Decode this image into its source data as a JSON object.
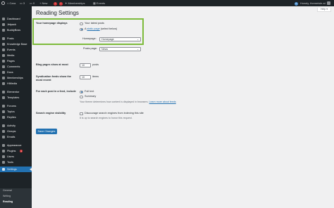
{
  "admin_bar": {
    "site_name": "Cara",
    "comments_count": "3",
    "updates_count": "0",
    "new_label": "+ New",
    "items": [
      "Memberships",
      "Events"
    ],
    "greeting": "Howdy, themeisle-st"
  },
  "sidebar": {
    "items": [
      {
        "label": "Dashboard"
      },
      {
        "label": "Jetpack"
      },
      {
        "label": "BuddyBoss"
      },
      {
        "label": "Posts"
      },
      {
        "label": "Knowledge Base"
      },
      {
        "label": "Events"
      },
      {
        "label": "Media"
      },
      {
        "label": "Pages"
      },
      {
        "label": "Comments"
      },
      {
        "label": "Docs"
      },
      {
        "label": "Memberships"
      },
      {
        "label": "HiMedia"
      },
      {
        "label": "Elementor"
      },
      {
        "label": "Templates"
      },
      {
        "label": "Forums"
      },
      {
        "label": "Topics"
      },
      {
        "label": "Replies"
      },
      {
        "label": "Activity"
      },
      {
        "label": "Groups"
      },
      {
        "label": "Emails"
      },
      {
        "label": "Appearance"
      },
      {
        "label": "Plugins",
        "count": "1"
      },
      {
        "label": "Users"
      },
      {
        "label": "Tools"
      },
      {
        "label": "Settings"
      }
    ],
    "submenu": [
      "General",
      "Writing",
      "Reading"
    ]
  },
  "help_tab": "Help ▾",
  "page_title": "Reading Settings",
  "homepage": {
    "label": "Your homepage displays",
    "option_latest": "Your latest posts",
    "option_static_prefix": "A ",
    "option_static_link": "static page",
    "option_static_suffix": " (select below)",
    "homepage_label": "Homepage:",
    "homepage_value": "Homepage",
    "posts_page_label": "Posts page:",
    "posts_page_value": "News"
  },
  "blog_pages": {
    "label": "Blog pages show at most",
    "value": "10",
    "unit": "posts"
  },
  "syndication": {
    "label": "Syndication feeds show the most recent",
    "value": "10",
    "unit": "items"
  },
  "feed": {
    "label": "For each post in a feed, include",
    "option_full": "Full text",
    "option_summary": "Summary",
    "note_prefix": "Your theme determines how content is displayed in browsers. ",
    "note_link": "Learn more about feeds"
  },
  "visibility": {
    "label": "Search engine visibility",
    "checkbox_label": "Discourage search engines from indexing this site",
    "note": "It is up to search engines to honor this request."
  },
  "save_label": "Save Changes"
}
